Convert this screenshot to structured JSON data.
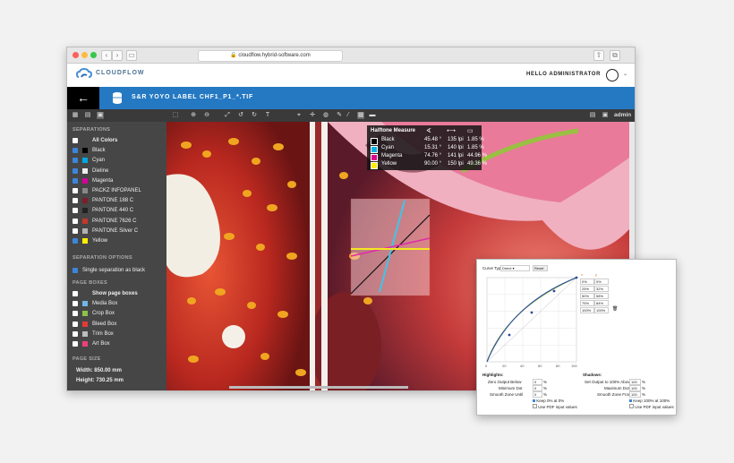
{
  "browser": {
    "url": "cloudflow.hybrid-software.com"
  },
  "app": {
    "logo": "CLOUDFLOW",
    "greeting": "HELLO ADMINISTRATOR",
    "back_glyph": "🡐",
    "document_title": "S&R YOYO LABEL CHF1_P1_*.TIF",
    "user": "admin"
  },
  "sidebar": {
    "separations_header": "SEPARATIONS",
    "separations": [
      {
        "label": "All Colors",
        "checked": false,
        "swatch": ""
      },
      {
        "label": "Black",
        "checked": true,
        "swatch": "#000000"
      },
      {
        "label": "Cyan",
        "checked": true,
        "swatch": "#00a8e0"
      },
      {
        "label": "Dieline",
        "checked": true,
        "swatch": "#eeeeee"
      },
      {
        "label": "Magenta",
        "checked": true,
        "swatch": "#d4009a"
      },
      {
        "label": "PACKZ INFOPANEL",
        "checked": false,
        "swatch": "#888888"
      },
      {
        "label": "PANTONE 188 C",
        "checked": false,
        "swatch": "#7a1f2b"
      },
      {
        "label": "PANTONE 440 C",
        "checked": false,
        "swatch": "#222222"
      },
      {
        "label": "PANTONE 7626 C",
        "checked": false,
        "swatch": "#c0392b"
      },
      {
        "label": "PANTONE Silver C",
        "checked": false,
        "swatch": "#b0b0b0"
      },
      {
        "label": "Yellow",
        "checked": true,
        "swatch": "#ffee00"
      }
    ],
    "options_header": "SEPARATION OPTIONS",
    "single_separation": "Single separation as black",
    "pageboxes_header": "PAGE BOXES",
    "pageboxes": [
      {
        "label": "Show page boxes",
        "checked": false,
        "swatch": ""
      },
      {
        "label": "Media Box",
        "checked": false,
        "swatch": "#6fb6e8"
      },
      {
        "label": "Crop Box",
        "checked": false,
        "swatch": "#8bc34a"
      },
      {
        "label": "Bleed Box",
        "checked": false,
        "swatch": "#e53935"
      },
      {
        "label": "Trim Box",
        "checked": false,
        "swatch": "#bdbdbd"
      },
      {
        "label": "Art Box",
        "checked": false,
        "swatch": "#ec407a"
      }
    ],
    "pagesize_header": "PAGE SIZE",
    "width": "Width: 850.00 mm",
    "height": "Height: 730.25 mm"
  },
  "halftone": {
    "title": "Halftone Measure",
    "rows": [
      {
        "name": "Black",
        "angle": "45.48 °",
        "lpi": "135 lpi",
        "pct": "1.85 %",
        "color": "#000000"
      },
      {
        "name": "Cyan",
        "angle": "15.31 °",
        "lpi": "140 lpi",
        "pct": "1.85 %",
        "color": "#00b5e8"
      },
      {
        "name": "Magenta",
        "angle": "74.76 °",
        "lpi": "141 lpi",
        "pct": "44.96 %",
        "color": "#e0008f"
      },
      {
        "name": "Yellow",
        "angle": "90.00 °",
        "lpi": "150 lpi",
        "pct": "49.36 %",
        "color": "#ffee00"
      }
    ]
  },
  "curve": {
    "type_label": "Curve Type",
    "type_value": "Direct",
    "reset": "Reset",
    "table": [
      [
        "0%",
        "0%"
      ],
      [
        "25%",
        "32%"
      ],
      [
        "50%",
        "58%"
      ],
      [
        "75%",
        "84%"
      ],
      [
        "100%",
        "100%"
      ]
    ],
    "highlights": "Highlights:",
    "shadows": "Shadows:",
    "zero_output": "Zero Output Below",
    "zero_val": "0",
    "zero_unit": "%",
    "min_dot": "Minimum Dot",
    "min_val": "0",
    "min_unit": "%",
    "smooth_until": "Smooth Zone Until",
    "smooth_val": "0",
    "smooth_unit": "%",
    "keep0": "Keep 0% at 0%",
    "use_pdf": "Use PDF input values",
    "set_output": "Set Output to 100% Above",
    "set_val": "100",
    "set_unit": "%",
    "max_dot": "Maximum Dot",
    "max_val": "100",
    "max_unit": "%",
    "smooth_from": "Smooth Zone From",
    "from_val": "100",
    "from_unit": "%",
    "keep100": "Keep 100% at 100%",
    "use_pdf2": "Use PDF input values",
    "axis": [
      "0",
      "20",
      "40",
      "60",
      "80",
      "100"
    ]
  }
}
